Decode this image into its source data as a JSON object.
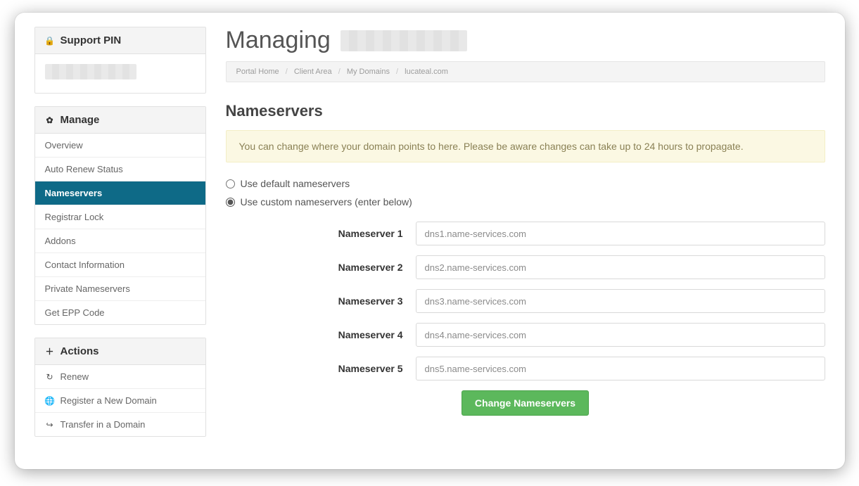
{
  "sidebar": {
    "support_pin": {
      "title": "Support PIN"
    },
    "manage": {
      "title": "Manage",
      "items": [
        {
          "label": "Overview"
        },
        {
          "label": "Auto Renew Status"
        },
        {
          "label": "Nameservers"
        },
        {
          "label": "Registrar Lock"
        },
        {
          "label": "Addons"
        },
        {
          "label": "Contact Information"
        },
        {
          "label": "Private Nameservers"
        },
        {
          "label": "Get EPP Code"
        }
      ]
    },
    "actions": {
      "title": "Actions",
      "items": [
        {
          "label": "Renew"
        },
        {
          "label": "Register a New Domain"
        },
        {
          "label": "Transfer in a Domain"
        }
      ]
    }
  },
  "header": {
    "title_prefix": "Managing"
  },
  "breadcrumb": {
    "items": [
      "Portal Home",
      "Client Area",
      "My Domains",
      "lucateal.com"
    ]
  },
  "main": {
    "section_title": "Nameservers",
    "alert": "You can change where your domain points to here. Please be aware changes can take up to 24 hours to propagate.",
    "option_default": "Use default nameservers",
    "option_custom": "Use custom nameservers (enter below)",
    "ns_labels": [
      "Nameserver 1",
      "Nameserver 2",
      "Nameserver 3",
      "Nameserver 4",
      "Nameserver 5"
    ],
    "ns_values": [
      "dns1.name-services.com",
      "dns2.name-services.com",
      "dns3.name-services.com",
      "dns4.name-services.com",
      "dns5.name-services.com"
    ],
    "submit_label": "Change Nameservers"
  }
}
